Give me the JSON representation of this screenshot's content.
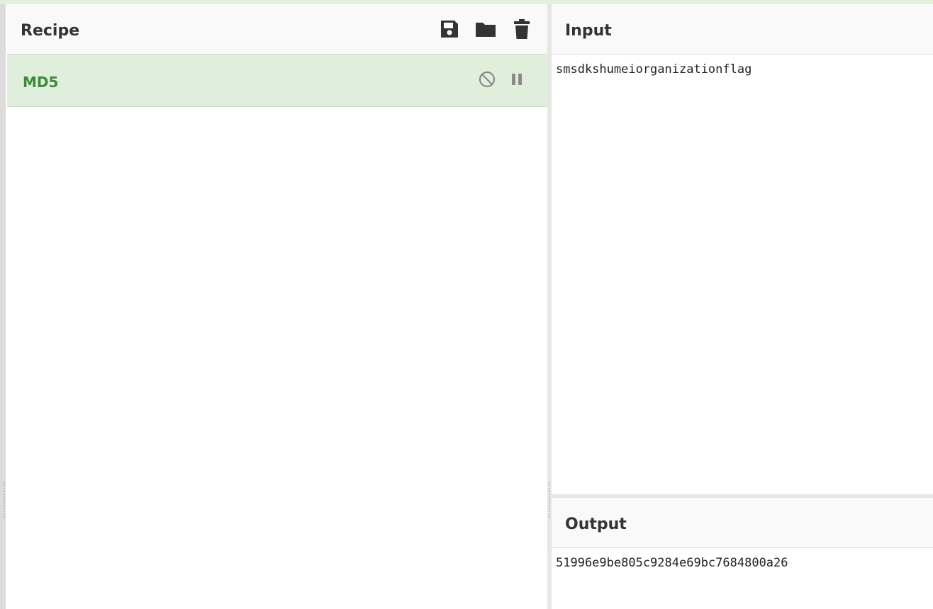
{
  "recipe": {
    "title": "Recipe",
    "icons": [
      "save-icon",
      "folder-open-icon",
      "trash-icon"
    ],
    "operations": [
      {
        "name": "MD5",
        "icons": [
          "disable-icon",
          "pause-icon"
        ]
      }
    ]
  },
  "input": {
    "title": "Input",
    "value": "smsdkshumeiorganizationflag"
  },
  "output": {
    "title": "Output",
    "value": "51996e9be805c9284e69bc7684800a26"
  },
  "colors": {
    "accent_green": "#3d8a3a",
    "op_background": "#dfefdb",
    "header_background": "#f9f9f9",
    "icon_dark": "#333333",
    "icon_muted": "#8a8a8a"
  }
}
